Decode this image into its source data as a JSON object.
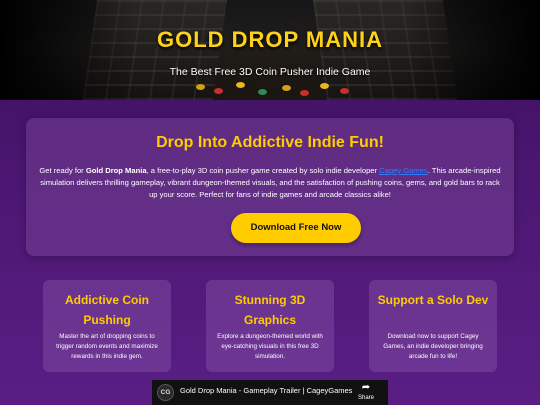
{
  "hero": {
    "title": "GOLD DROP MANIA",
    "subtitle": "The Best Free 3D Coin Pusher Indie Game"
  },
  "intro": {
    "heading": "Drop Into Addictive Indie Fun!",
    "text_before_bold": "Get ready for ",
    "bold_name": "Gold Drop Mania",
    "text_after_bold": ", a free-to-play 3D coin pusher game created by solo indie developer ",
    "developer_link": "Cagey Games",
    "text_end": ". This arcade-inspired simulation delivers thrilling gameplay, vibrant dungeon-themed visuals, and the satisfaction of pushing coins, gems, and gold bars to rack up your score. Perfect for fans of indie games and arcade classics alike!",
    "download_button": "Download Free Now"
  },
  "features": [
    {
      "title": "Addictive Coin Pushing",
      "text": "Master the art of dropping coins to trigger random events and maximize rewards in this indie gem."
    },
    {
      "title": "Stunning 3D Graphics",
      "text": "Explore a dungeon-themed world with eye-catching visuals in this free 3D simulation."
    },
    {
      "title": "Support a Solo Dev",
      "text": "Download now to support Cagey Games, an indie developer bringing arcade fun to life!"
    }
  ],
  "video": {
    "channel_initials": "CG",
    "title": "Gold Drop Mania - Gameplay Trailer | CageyGames",
    "share_label": "Share",
    "share_icon": "share-arrow-icon"
  },
  "colors": {
    "accent_gold": "#ffcc00",
    "background_purple": "#4a1670",
    "link_blue": "#2f7cff"
  }
}
